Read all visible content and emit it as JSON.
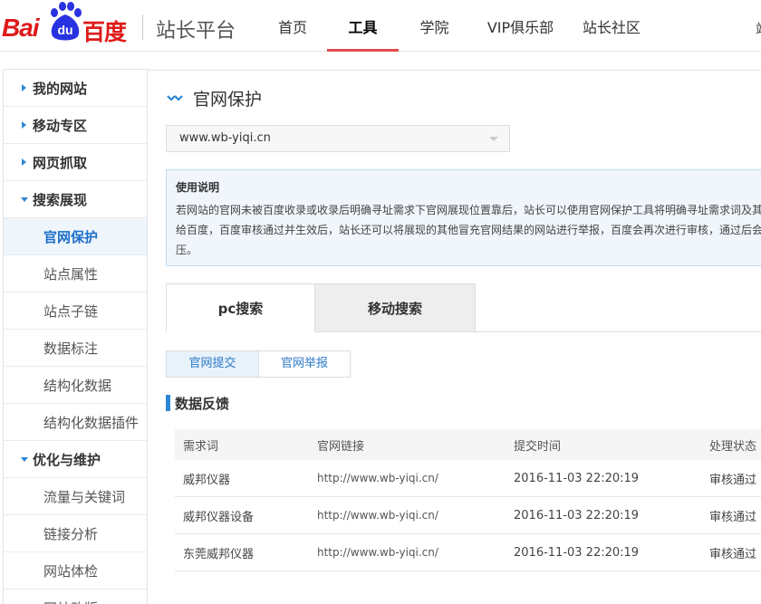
{
  "header": {
    "logo": {
      "text_bai": "Bai",
      "text_du": "du",
      "text_cn": "百度"
    },
    "site_title": "站长平台",
    "nav": [
      {
        "label": "首页"
      },
      {
        "label": "工具",
        "active": true
      },
      {
        "label": "学院"
      },
      {
        "label": "VIP俱乐部"
      },
      {
        "label": "站长社区"
      }
    ],
    "nav_overflow": "站"
  },
  "sidebar": {
    "items": [
      {
        "label": "我的网站",
        "type": "group",
        "expanded": false
      },
      {
        "label": "移动专区",
        "type": "group",
        "expanded": false
      },
      {
        "label": "网页抓取",
        "type": "group",
        "expanded": false
      },
      {
        "label": "搜索展现",
        "type": "group",
        "expanded": true
      },
      {
        "label": "官网保护",
        "type": "sub",
        "active": true
      },
      {
        "label": "站点属性",
        "type": "sub"
      },
      {
        "label": "站点子链",
        "type": "sub"
      },
      {
        "label": "数据标注",
        "type": "sub"
      },
      {
        "label": "结构化数据",
        "type": "sub"
      },
      {
        "label": "结构化数据插件",
        "type": "sub"
      },
      {
        "label": "优化与维护",
        "type": "group",
        "expanded": true
      },
      {
        "label": "流量与关键词",
        "type": "sub"
      },
      {
        "label": "链接分析",
        "type": "sub"
      },
      {
        "label": "网站体检",
        "type": "sub"
      },
      {
        "label": "网站改版",
        "type": "sub"
      }
    ]
  },
  "main": {
    "page_title": "官网保护",
    "site_select": {
      "value": "www.wb-yiqi.cn"
    },
    "notice": {
      "title": "使用说明",
      "lines": [
        "若网站的官网未被百度收录或收录后明确寻址需求下官网展现位置靠后，站长可以使用官网保护工具将明确寻址需求词及其",
        "给百度，百度审核通过并生效后，站长还可以将展现的其他冒充官网结果的网站进行举报，百度会再次进行审核，通过后会",
        "压。"
      ]
    },
    "tabs": [
      {
        "label": "pc搜索",
        "active": true
      },
      {
        "label": "移动搜索",
        "active": false
      }
    ],
    "subtabs": [
      {
        "label": "官网提交",
        "active": true
      },
      {
        "label": "官网举报",
        "active": false
      }
    ],
    "section_title": "数据反馈",
    "table": {
      "columns": [
        "需求词",
        "官网链接",
        "提交时间",
        "处理状态"
      ],
      "rows": [
        [
          "威邦仪器",
          "http://www.wb-yiqi.cn/",
          "2016-11-03 22:20:19",
          "审核通过"
        ],
        [
          "威邦仪器设备",
          "http://www.wb-yiqi.cn/",
          "2016-11-03 22:20:19",
          "审核通过"
        ],
        [
          "东莞威邦仪器",
          "http://www.wb-yiqi.cn/",
          "2016-11-03 22:20:19",
          "审核通过"
        ]
      ]
    }
  },
  "colors": {
    "brand_red": "#de1a1a",
    "brand_blue": "#2d87d3",
    "active_nav_underline": "#e24b4b",
    "link_blue": "#2b79c6",
    "notice_bg": "#f0f6fb"
  }
}
